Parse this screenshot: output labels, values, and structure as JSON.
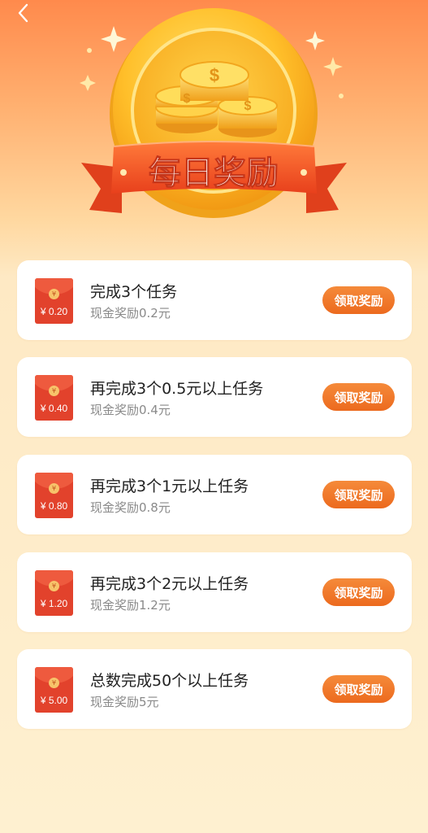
{
  "nav": {
    "back_icon": "chevron-left-icon"
  },
  "banner": {
    "title": "每日奖励"
  },
  "colors": {
    "accent": "#ec6a1e",
    "envelope": "#e2422c",
    "background": "#fef0d0"
  },
  "tasks": [
    {
      "amount": "¥ 0.20",
      "title": "完成3个任务",
      "reward": "现金奖励0.2元",
      "button": "领取奖励"
    },
    {
      "amount": "¥ 0.40",
      "title": "再完成3个0.5元以上任务",
      "reward": "现金奖励0.4元",
      "button": "领取奖励"
    },
    {
      "amount": "¥ 0.80",
      "title": "再完成3个1元以上任务",
      "reward": "现金奖励0.8元",
      "button": "领取奖励"
    },
    {
      "amount": "¥ 1.20",
      "title": "再完成3个2元以上任务",
      "reward": "现金奖励1.2元",
      "button": "领取奖励"
    },
    {
      "amount": "¥ 5.00",
      "title": "总数完成50个以上任务",
      "reward": "现金奖励5元",
      "button": "领取奖励"
    }
  ]
}
